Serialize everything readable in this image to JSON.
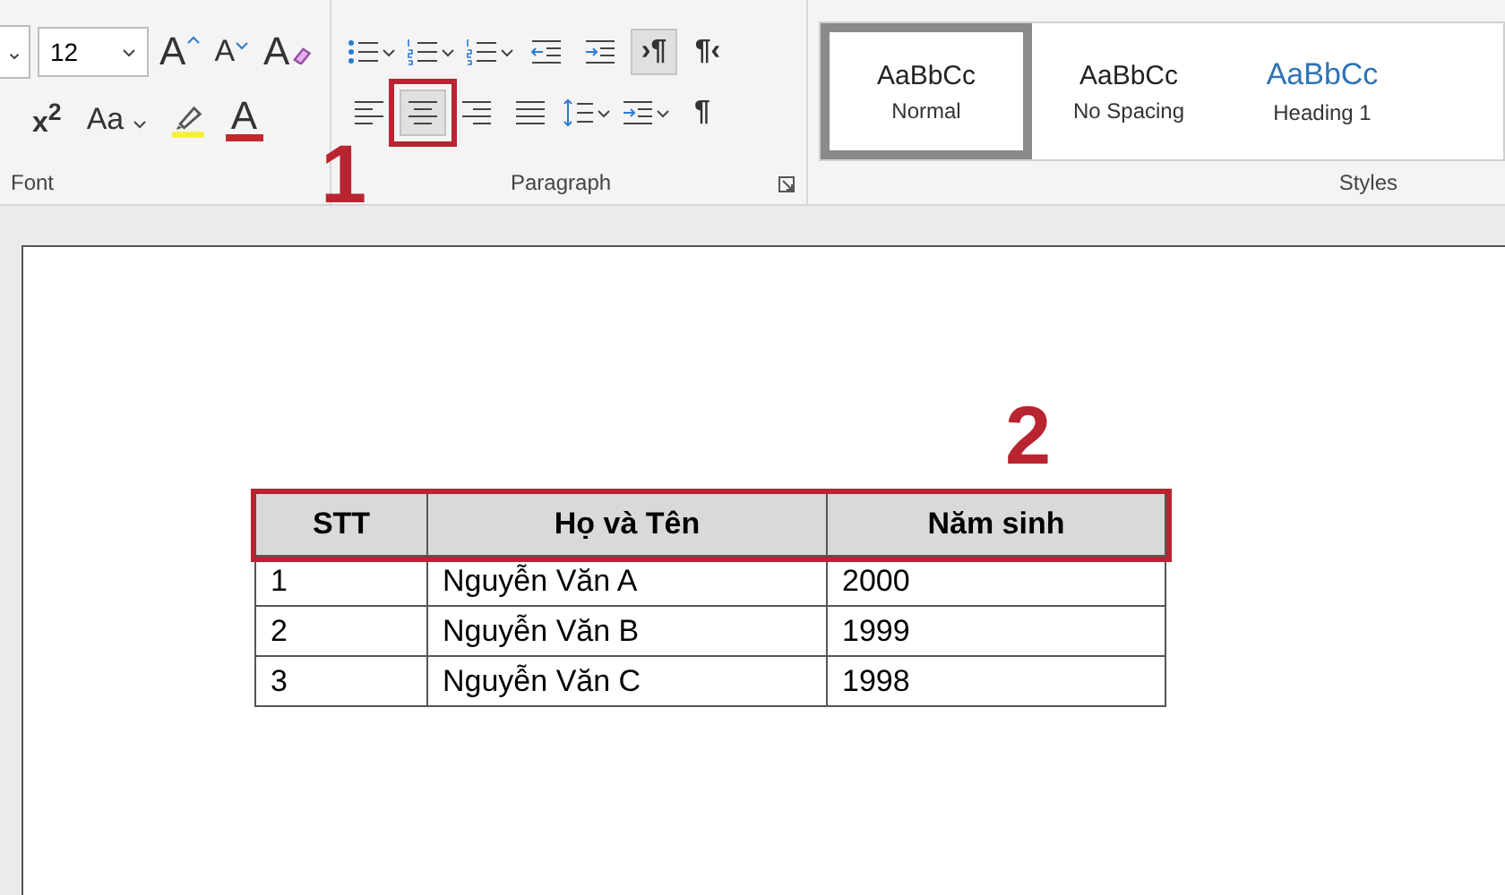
{
  "ribbon": {
    "font_group": {
      "label": "Font",
      "font_name_caret": "⌄",
      "size_value": "12",
      "row1": [
        {
          "kind": "grow",
          "glyph": "A"
        },
        {
          "kind": "shrink",
          "glyph": "A"
        },
        {
          "kind": "clear",
          "glyph": "A"
        }
      ],
      "row2": [
        {
          "kind": "superscript",
          "glyph": "x$^{2}$"
        },
        {
          "kind": "case",
          "glyph": "Aa"
        },
        {
          "kind": "highlight"
        },
        {
          "kind": "fontcolor",
          "glyph": "A"
        }
      ]
    },
    "paragraph_group": {
      "label": "Paragraph",
      "row1": [
        {
          "kind": "bullets",
          "selected": false
        },
        {
          "kind": "numbering",
          "selected": false
        },
        {
          "kind": "multilevel",
          "selected": false
        },
        {
          "kind": "outdent",
          "selected": false
        },
        {
          "kind": "indent",
          "selected": false
        },
        {
          "kind": "ltr",
          "glyph": "›¶",
          "selected": true
        },
        {
          "kind": "rtl",
          "glyph": "¶‹",
          "selected": false
        }
      ],
      "row2": [
        {
          "kind": "align-left",
          "selected": false
        },
        {
          "kind": "align-center",
          "selected": true
        },
        {
          "kind": "align-right",
          "selected": false
        },
        {
          "kind": "justify",
          "selected": false
        },
        {
          "kind": "spacing",
          "selected": false
        },
        {
          "kind": "shading",
          "selected": false
        },
        {
          "kind": "pilcrow",
          "glyph": "¶",
          "selected": false
        }
      ]
    },
    "styles_group": {
      "label": "Styles",
      "items": [
        {
          "preview": "AaBbCc",
          "name": "Normal",
          "selected": true
        },
        {
          "preview": "AaBbCc",
          "name": "No Spacing",
          "selected": false
        },
        {
          "preview": "AaBbCc",
          "name": "Heading 1",
          "selected": false
        }
      ]
    }
  },
  "annotations": [
    {
      "number": "1"
    },
    {
      "number": "2"
    }
  ],
  "table": {
    "columns": [
      "STT",
      "Họ và Tên",
      "Năm sinh"
    ],
    "rows": [
      [
        "1",
        "Nguyễn Văn A",
        "2000"
      ],
      [
        "2",
        "Nguyễn Văn B",
        "1999"
      ],
      [
        "3",
        "Nguyễn Văn C",
        "1998"
      ]
    ]
  }
}
